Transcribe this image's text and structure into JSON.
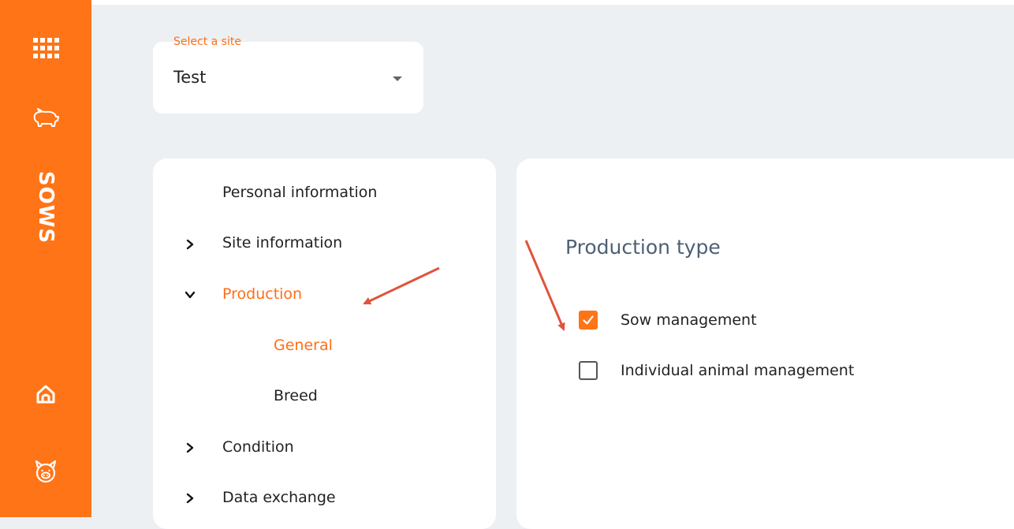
{
  "sidebar": {
    "brand": "SOWS",
    "icons": [
      "apps-grid-icon",
      "pig-outline-icon",
      "home-icon",
      "pig-face-icon"
    ]
  },
  "site_selector": {
    "label": "Select a site",
    "value": "Test"
  },
  "nav": {
    "items": [
      {
        "label": "Personal information",
        "expandable": false
      },
      {
        "label": "Site information",
        "expandable": true,
        "expanded": false
      },
      {
        "label": "Production",
        "expandable": true,
        "expanded": true,
        "active": true,
        "children": [
          {
            "label": "General",
            "active": true
          },
          {
            "label": "Breed",
            "active": false
          }
        ]
      },
      {
        "label": "Condition",
        "expandable": true,
        "expanded": false
      },
      {
        "label": "Data exchange",
        "expandable": true,
        "expanded": false
      }
    ]
  },
  "content": {
    "title": "Production type",
    "options": [
      {
        "label": "Sow management",
        "checked": true
      },
      {
        "label": "Individual animal management",
        "checked": false
      }
    ]
  },
  "colors": {
    "accent": "#ff7417",
    "title": "#4e6074",
    "annotation": "#e0533c",
    "background": "#edf0f3"
  }
}
